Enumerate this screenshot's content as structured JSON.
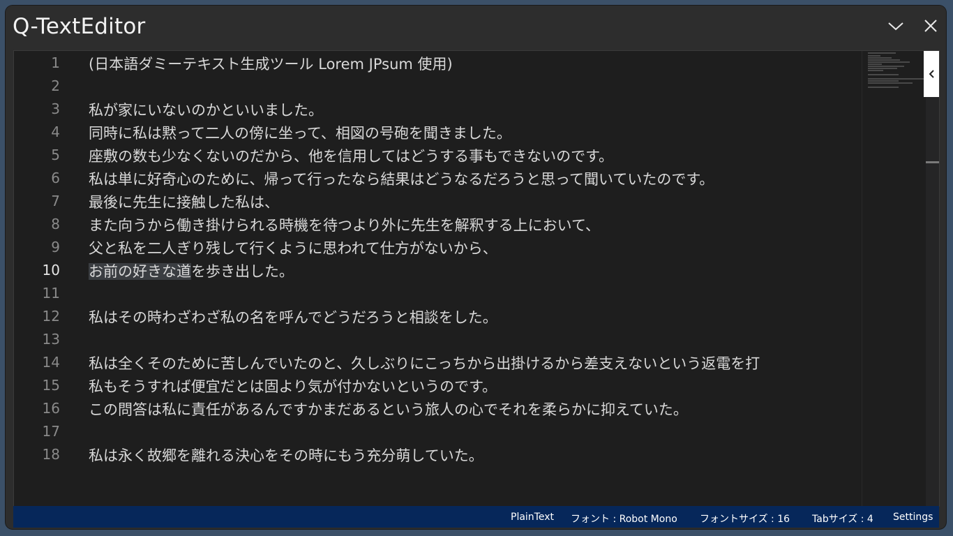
{
  "window": {
    "title": "Q-TextEditor"
  },
  "editor": {
    "active_line": 10,
    "selected_text": "お前の好きな道",
    "selected_rest": "を歩き出した。",
    "lines": [
      {
        "num": "1",
        "text": "(日本語ダミーテキスト生成ツール Lorem JPsum 使用)"
      },
      {
        "num": "2",
        "text": ""
      },
      {
        "num": "3",
        "text": "私が家にいないのかといいました。"
      },
      {
        "num": "4",
        "text": "同時に私は黙って二人の傍に坐って、相図の号砲を聞きました。"
      },
      {
        "num": "5",
        "text": "座敷の数も少なくないのだから、他を信用してはどうする事もできないのです。"
      },
      {
        "num": "6",
        "text": "私は単に好奇心のために、帰って行ったなら結果はどうなるだろうと思って聞いていたのです。"
      },
      {
        "num": "7",
        "text": "最後に先生に接触した私は、"
      },
      {
        "num": "8",
        "text": "また向うから働き掛けられる時機を待つより外に先生を解釈する上において、"
      },
      {
        "num": "9",
        "text": "父と私を二人ぎり残して行くように思われて仕方がないから、"
      },
      {
        "num": "10",
        "text": "お前の好きな道を歩き出した。"
      },
      {
        "num": "11",
        "text": ""
      },
      {
        "num": "12",
        "text": "私はその時わざわざ私の名を呼んでどうだろうと相談をした。"
      },
      {
        "num": "13",
        "text": ""
      },
      {
        "num": "14",
        "text": "私は全くそのために苦しんでいたのと、久しぶりにこっちから出掛けるから差支えないという返電を打"
      },
      {
        "num": "15",
        "text": "私もそうすれば便宜だとは固より気が付かないというのです。"
      },
      {
        "num": "16",
        "text": "この問答は私に責任があるんですかまだあるという旅人の心でそれを柔らかに抑えていた。"
      },
      {
        "num": "17",
        "text": ""
      },
      {
        "num": "18",
        "text": "私は永く故郷を離れる決心をその時にもう充分萌していた。"
      }
    ]
  },
  "statusbar": {
    "language": "PlainText",
    "font": "フォント : Robot Mono",
    "font_size": "フォントサイズ : 16",
    "tab_size": "Tabサイズ : 4",
    "settings": "Settings"
  },
  "icons": {
    "collapse": "chevron-down-icon",
    "close": "close-icon",
    "panel_toggle": "chevron-left-icon"
  },
  "colors": {
    "statusbar_bg": "#06275a",
    "editor_bg": "#1e1e1e",
    "titlebar_bg": "#2d2d2d",
    "desktop_bg": "#3b5068"
  }
}
